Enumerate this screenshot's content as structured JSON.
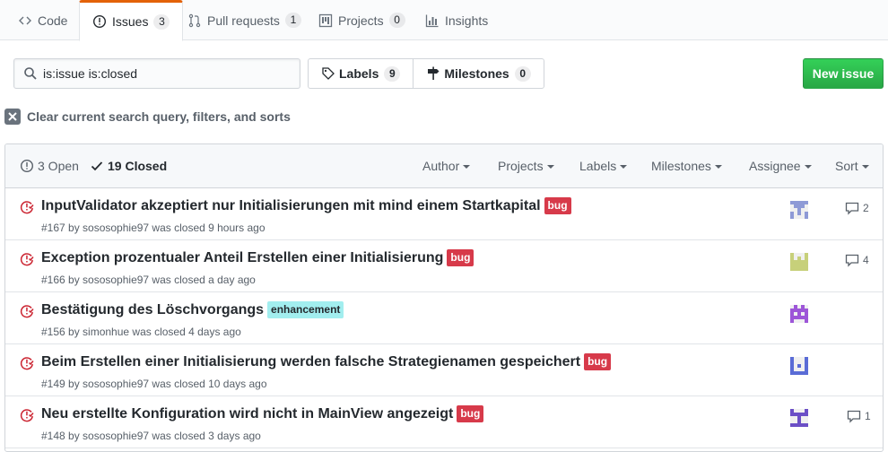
{
  "colors": {
    "accent": "#e36209",
    "green": "#28a745",
    "bug": "#d73a4a",
    "enhancement": "#a2eeef",
    "closed_icon": "#cb2431"
  },
  "tabs": [
    {
      "label": "Code",
      "icon": "code-icon",
      "count": null
    },
    {
      "label": "Issues",
      "icon": "issue-opened-icon",
      "count": "3"
    },
    {
      "label": "Pull requests",
      "icon": "git-pull-request-icon",
      "count": "1"
    },
    {
      "label": "Projects",
      "icon": "project-icon",
      "count": "0"
    },
    {
      "label": "Insights",
      "icon": "graph-icon",
      "count": null
    }
  ],
  "search": {
    "value": "is:issue is:closed",
    "icon": "search-icon"
  },
  "labels_button": {
    "label": "Labels",
    "count": "9"
  },
  "milestones_button": {
    "label": "Milestones",
    "count": "0"
  },
  "new_issue_label": "New issue",
  "clear_filters_label": "Clear current search query, filters, and sorts",
  "states": {
    "open": "3 Open",
    "closed": "19 Closed"
  },
  "filters": [
    "Author",
    "Projects",
    "Labels",
    "Milestones",
    "Assignee",
    "Sort"
  ],
  "issues": [
    {
      "title": "InputValidator akzeptiert nur Initialisierungen mit mind einem Startkapital",
      "label": "bug",
      "meta": "#167 by sososophie97 was closed 9 hours ago",
      "comments": "2",
      "avatar_color": "#8e9ad6"
    },
    {
      "title": "Exception prozentualer Anteil Erstellen einer Initialisierung",
      "label": "bug",
      "meta": "#166 by sososophie97 was closed a day ago",
      "comments": "4",
      "avatar_color": "#c7d07a"
    },
    {
      "title": "Bestätigung des Löschvorgangs",
      "label": "enhancement",
      "meta": "#156 by simonhue was closed 4 days ago",
      "comments": "",
      "avatar_color": "#9d56d8"
    },
    {
      "title": "Beim Erstellen einer Initialisierung werden falsche Strategienamen gespeichert",
      "label": "bug",
      "meta": "#149 by sososophie97 was closed 10 days ago",
      "comments": "",
      "avatar_color": "#5a6cd6"
    },
    {
      "title": "Neu erstellte Konfiguration wird nicht in MainView angezeigt",
      "label": "bug",
      "meta": "#148 by sososophie97 was closed 3 days ago",
      "comments": "1",
      "avatar_color": "#6b4fc6"
    }
  ]
}
